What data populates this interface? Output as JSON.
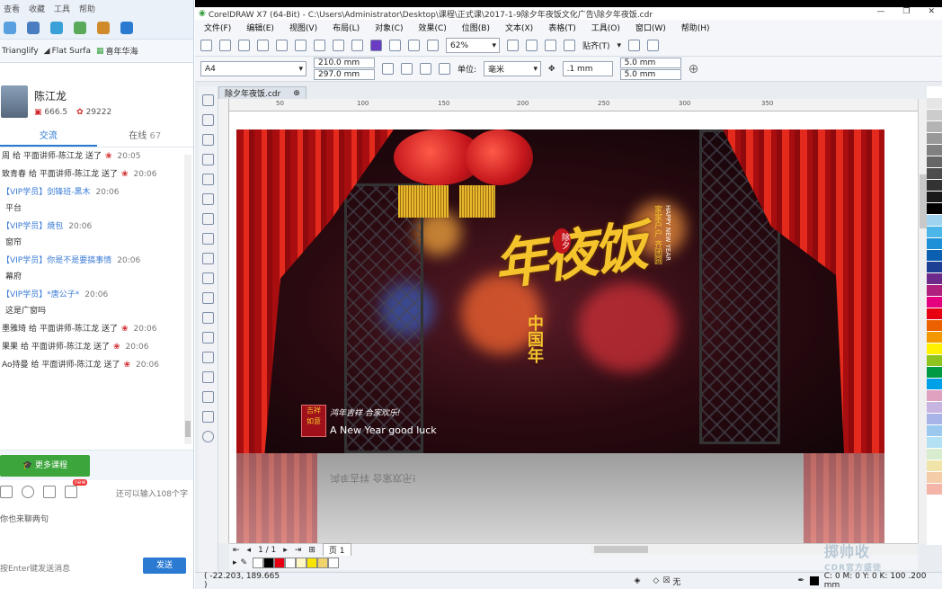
{
  "chat": {
    "menu": [
      "查看",
      "收藏",
      "工具",
      "帮助"
    ],
    "bookmarks": [
      "Trianglify",
      "Flat Surfa",
      "喜年华海"
    ],
    "user": {
      "name": "陈江龙",
      "coins": "666.5",
      "flowers": "29222"
    },
    "tabs": [
      {
        "label": "交流"
      },
      {
        "label": "在线",
        "count": "67"
      }
    ],
    "messages": [
      {
        "from": "周",
        "text": "给 平面讲师-陈江龙 送了",
        "time": "20:05",
        "gift": true
      },
      {
        "from": "致青春",
        "text": "给 平面讲师-陈江龙 送了",
        "time": "20:06",
        "gift": true
      },
      {
        "from": "【VIP学员】剑锋班-黑木",
        "time": "20:06",
        "body": "平台"
      },
      {
        "from": "【VIP学员】焼包",
        "time": "20:06",
        "body": "窗帘"
      },
      {
        "from": "【VIP学员】你是不是要搞事情",
        "time": "20:06",
        "body": "幕府"
      },
      {
        "from": "【VIP学员】*唐公子*",
        "time": "20:06",
        "body": "这是广窗吗"
      },
      {
        "from": "墨雅琦",
        "text": "给 平面讲师-陈江龙 送了",
        "time": "20:06",
        "gift": true
      },
      {
        "from": "果果",
        "text": "给 平面讲师-陈江龙 送了",
        "time": "20:06",
        "gift": true
      },
      {
        "from": "Ao持曼",
        "text": "给 平面讲师-陈江龙 送了",
        "time": "20:06",
        "gift": true
      }
    ],
    "more_courses": "更多课程",
    "remaining": "还可以输入108个字",
    "placeholder": "你也来聊两句",
    "hint": "按Enter键发送消息",
    "send": "发送",
    "new_badge": "new"
  },
  "corel": {
    "title": "CorelDRAW X7 (64-Bit) - C:\\Users\\Administrator\\Desktop\\课程\\正式课\\2017-1-9除夕年夜饭文化广告\\除夕年夜饭.cdr",
    "menu": [
      "文件(F)",
      "编辑(E)",
      "视图(V)",
      "布局(L)",
      "对象(C)",
      "效果(C)",
      "位图(B)",
      "文本(X)",
      "表格(T)",
      "工具(O)",
      "窗口(W)",
      "帮助(H)"
    ],
    "zoom": "62%",
    "snap_label": "贴齐(T)",
    "page_size": "A4",
    "width": "210.0 mm",
    "height": "297.0 mm",
    "units_label": "单位:",
    "units": "毫米",
    "nudge": ".1 mm",
    "dup_x": "5.0 mm",
    "dup_y": "5.0 mm",
    "doc_tab": "除夕年夜饭.cdr",
    "ruler_ticks": [
      "50",
      "100",
      "150",
      "200",
      "250",
      "300",
      "350"
    ],
    "page_nav": "1 / 1",
    "page_tab": "页 1",
    "coords": "( -22.203, 189.665 )",
    "fill_none": "无",
    "color_readout": "C: 0 M: 0 Y: 0 K: 100  .200 mm",
    "watermark_top": "掷帅收",
    "watermark_bottom": "CDR官方盛徒",
    "palette": [
      "#ffffff",
      "#e6e6e6",
      "#cccccc",
      "#b3b3b3",
      "#999999",
      "#808080",
      "#666666",
      "#4d4d4d",
      "#333333",
      "#1a1a1a",
      "#000000",
      "#9fd3f0",
      "#4db6e8",
      "#1e90d8",
      "#0a5fb0",
      "#1c3f94",
      "#6e2a8a",
      "#b0207e",
      "#e4007f",
      "#e60012",
      "#eb6100",
      "#f39800",
      "#fff100",
      "#8fc31f",
      "#009944",
      "#00a0e9",
      "#e0a0c0",
      "#c8b4e0",
      "#a8b4e8",
      "#9ac8ee",
      "#b4e0f4",
      "#d8ecd0",
      "#f0e4a8",
      "#f4cca8",
      "#f4b4a8"
    ],
    "colorbar": [
      "#ffffff",
      "#000000",
      "#e60012",
      "#ffffff",
      "#fff7c4",
      "#f7e400",
      "#f0d36a",
      "#ffffff"
    ]
  },
  "artwork": {
    "title": "年夜饭",
    "eve": "除夕",
    "subtitle": "中国年",
    "happy": "HAPPY NEW YEAR",
    "poem": "家家户户 齐团圆",
    "seal": "聚会 欢乐",
    "wish": "鸿年吉祥 合家欢乐!",
    "english": "A New Year good luck",
    "stamp": "吉祥 如意"
  }
}
